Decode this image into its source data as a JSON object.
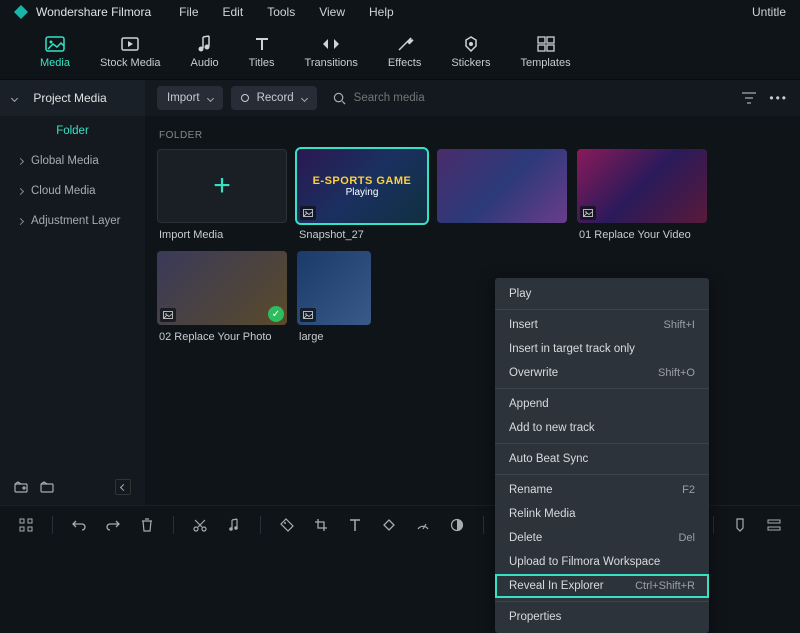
{
  "app": {
    "title": "Wondershare Filmora",
    "document": "Untitle"
  },
  "menubar": [
    "File",
    "Edit",
    "Tools",
    "View",
    "Help"
  ],
  "toolbar": [
    {
      "label": "Media",
      "icon": "media-icon",
      "active": true
    },
    {
      "label": "Stock Media",
      "icon": "stock-media-icon",
      "active": false
    },
    {
      "label": "Audio",
      "icon": "audio-icon",
      "active": false
    },
    {
      "label": "Titles",
      "icon": "titles-icon",
      "active": false
    },
    {
      "label": "Transitions",
      "icon": "transitions-icon",
      "active": false
    },
    {
      "label": "Effects",
      "icon": "effects-icon",
      "active": false
    },
    {
      "label": "Stickers",
      "icon": "stickers-icon",
      "active": false
    },
    {
      "label": "Templates",
      "icon": "templates-icon",
      "active": false
    }
  ],
  "sidebar": {
    "header": "Project Media",
    "items": [
      {
        "label": "Folder",
        "active": true
      },
      {
        "label": "Global Media",
        "active": false
      },
      {
        "label": "Cloud Media",
        "active": false
      },
      {
        "label": "Adjustment Layer",
        "active": false
      }
    ]
  },
  "content": {
    "import_label": "Import",
    "record_label": "Record",
    "search_placeholder": "Search media",
    "section_label": "FOLDER",
    "media": [
      {
        "label": "Import Media",
        "type": "import"
      },
      {
        "label": "Snapshot_27",
        "type": "esports",
        "selected": true,
        "title": "E-SPORTS GAME",
        "subtitle": "Playing"
      },
      {
        "label": "",
        "type": "streamer"
      },
      {
        "label": "01 Replace Your Video",
        "type": "gaming"
      },
      {
        "label": "02 Replace Your Photo",
        "type": "photo",
        "checked": true
      },
      {
        "label": "large",
        "type": "large"
      }
    ]
  },
  "context_menu": [
    {
      "label": "Play",
      "shortcut": ""
    },
    {
      "divider": true
    },
    {
      "label": "Insert",
      "shortcut": "Shift+I"
    },
    {
      "label": "Insert in target track only",
      "shortcut": ""
    },
    {
      "label": "Overwrite",
      "shortcut": "Shift+O"
    },
    {
      "divider": true
    },
    {
      "label": "Append",
      "shortcut": ""
    },
    {
      "label": "Add to new track",
      "shortcut": ""
    },
    {
      "divider": true
    },
    {
      "label": "Auto Beat Sync",
      "shortcut": ""
    },
    {
      "divider": true
    },
    {
      "label": "Rename",
      "shortcut": "F2"
    },
    {
      "label": "Relink Media",
      "shortcut": ""
    },
    {
      "label": "Delete",
      "shortcut": "Del"
    },
    {
      "label": "Upload to Filmora Workspace",
      "shortcut": ""
    },
    {
      "label": "Reveal In Explorer",
      "shortcut": "Ctrl+Shift+R",
      "highlighted": true
    },
    {
      "divider": true
    },
    {
      "label": "Properties",
      "shortcut": ""
    }
  ],
  "colors": {
    "accent": "#37e2c3",
    "bg": "#0f1419",
    "panel": "#14191f"
  }
}
